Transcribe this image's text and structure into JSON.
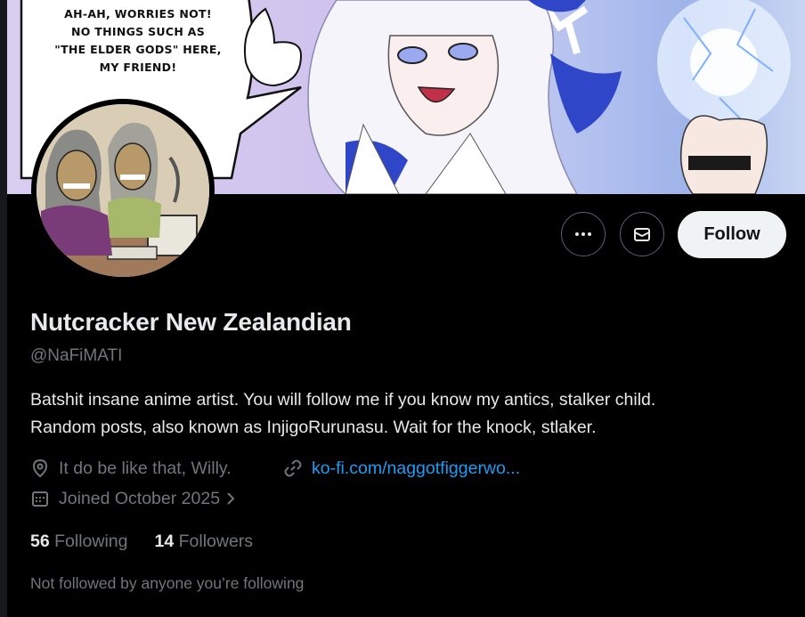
{
  "banner": {
    "speech_lines": [
      "AH-AH, WORRIES NOT!",
      "NO THINGS SUCH AS",
      "\"THE ELDER GODS\" HERE,",
      "MY FRIEND!"
    ],
    "speech_fragment": "1 D          O,"
  },
  "actions": {
    "more_icon": "more-horizontal-icon",
    "message_icon": "envelope-icon",
    "follow_label": "Follow"
  },
  "profile": {
    "display_name": "Nutcracker New Zealandian",
    "handle": "@NaFiMATI",
    "bio_line1": "Batshit insane anime artist. You will follow me if you know my antics, stalker child.",
    "bio_line2": "Random posts, also known as InjigoRurunasu. Wait for the knock, stlaker.",
    "location": "It do be like that, Willy.",
    "link": "ko-fi.com/naggotfiggerwo...",
    "joined": "Joined October 2025",
    "following_count": "56",
    "following_label": "Following",
    "followers_count": "14",
    "followers_label": "Followers",
    "mutuals_note": "Not followed by anyone you’re following"
  },
  "colors": {
    "background": "#000000",
    "text_primary": "#e7e9ea",
    "text_secondary": "#71767b",
    "link": "#1d9bf0",
    "follow_button_bg": "#eff3f4"
  }
}
